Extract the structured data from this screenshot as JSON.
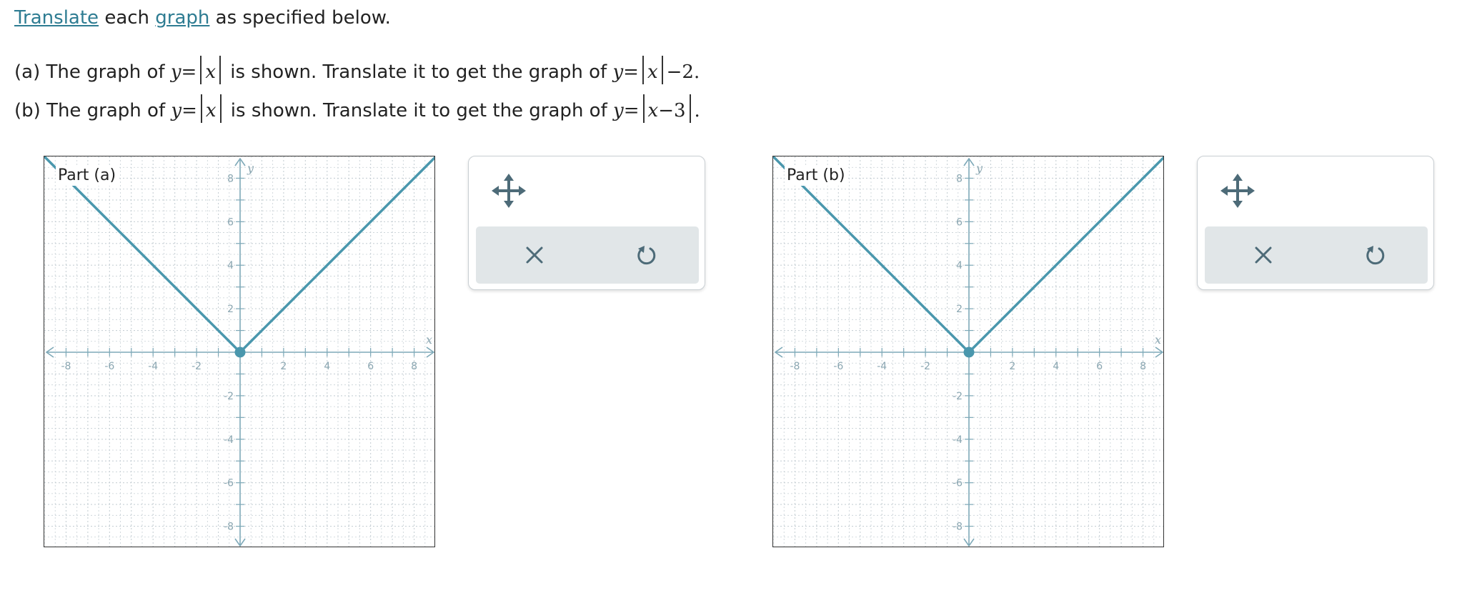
{
  "instructions": {
    "link1": "Translate",
    "mid": " each ",
    "link2": "graph",
    "tail": " as specified below."
  },
  "part_a_statement": {
    "prefix": "(a) The graph of ",
    "y1": "y",
    "eq1": "=",
    "x1": "x",
    "middle": " is shown. Translate it to get the graph of ",
    "y2": "y",
    "eq2": "=",
    "x2": "x",
    "tail": "−2."
  },
  "part_b_statement": {
    "prefix": "(b) The graph of ",
    "y1": "y",
    "eq1": "=",
    "x1": "x",
    "middle": " is shown. Translate it to get the graph of ",
    "y2": "y",
    "eq2": "=",
    "x2": "x",
    "minus": "−",
    "three": "3",
    "tail": "."
  },
  "graphs": [
    {
      "title": "Part (a)",
      "x_label": "x",
      "y_label": "y",
      "range": [
        -9,
        9
      ],
      "vertex": [
        0,
        0
      ],
      "function": "abs"
    },
    {
      "title": "Part (b)",
      "x_label": "x",
      "y_label": "y",
      "range": [
        -9,
        9
      ],
      "vertex": [
        0,
        0
      ],
      "function": "abs"
    }
  ],
  "axis_ticks": {
    "x_labels": [
      "-8",
      "-6",
      "-4",
      "-2",
      "2",
      "4",
      "6",
      "8"
    ],
    "y_labels": [
      "8",
      "6",
      "4",
      "2",
      "-2",
      "-4",
      "-6",
      "-8"
    ]
  },
  "tools": {
    "move_icon": "move-arrows-icon",
    "clear_icon": "x-icon",
    "undo_icon": "undo-icon"
  },
  "colors": {
    "graph_line": "#4a97ad",
    "axis": "#7ea9b8",
    "grid": "#c7d0d5",
    "tool_icon": "#4d6b78",
    "link": "#2e7c92"
  }
}
